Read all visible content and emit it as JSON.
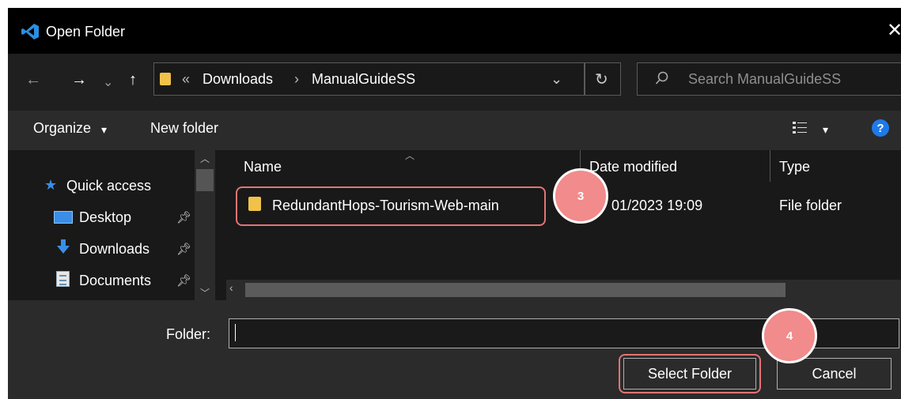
{
  "window": {
    "title": "Open Folder",
    "app_icon": "vscode-icon",
    "close_glyph": "✕"
  },
  "nav": {
    "back": "←",
    "forward": "→",
    "recent": "⌄",
    "up": "↑"
  },
  "address": {
    "overflow": "«",
    "segments": [
      "Downloads",
      "ManualGuideSS"
    ],
    "separator": "›",
    "dropdown": "⌄",
    "refresh": "↻"
  },
  "search": {
    "placeholder": "Search ManualGuideSS"
  },
  "toolbar": {
    "organize": "Organize",
    "organize_arrow": "▾",
    "new_folder": "New folder",
    "view_arrow": "▾",
    "help": "?"
  },
  "sidebar": {
    "items": [
      {
        "label": "Quick access",
        "icon": "star-icon"
      },
      {
        "label": "Desktop",
        "icon": "desktop-icon",
        "pinned": true
      },
      {
        "label": "Downloads",
        "icon": "download-icon",
        "pinned": true
      },
      {
        "label": "Documents",
        "icon": "documents-icon",
        "pinned": true
      }
    ]
  },
  "columns": {
    "name": "Name",
    "date": "Date modified",
    "type": "Type"
  },
  "files": [
    {
      "name": "RedundantHops-Tourism-Web-main",
      "date": "01/2023 19:09",
      "type": "File folder"
    }
  ],
  "bottom": {
    "folder_label": "Folder:",
    "folder_value": "",
    "select": "Select Folder",
    "cancel": "Cancel"
  },
  "annotations": {
    "step3": "3",
    "step4": "4"
  },
  "colors": {
    "highlight": "#e57373",
    "marker": "#f28b8b",
    "folder": "#f0c24a",
    "accent_blue": "#3a8ee6",
    "help_blue": "#1e7ae8"
  }
}
